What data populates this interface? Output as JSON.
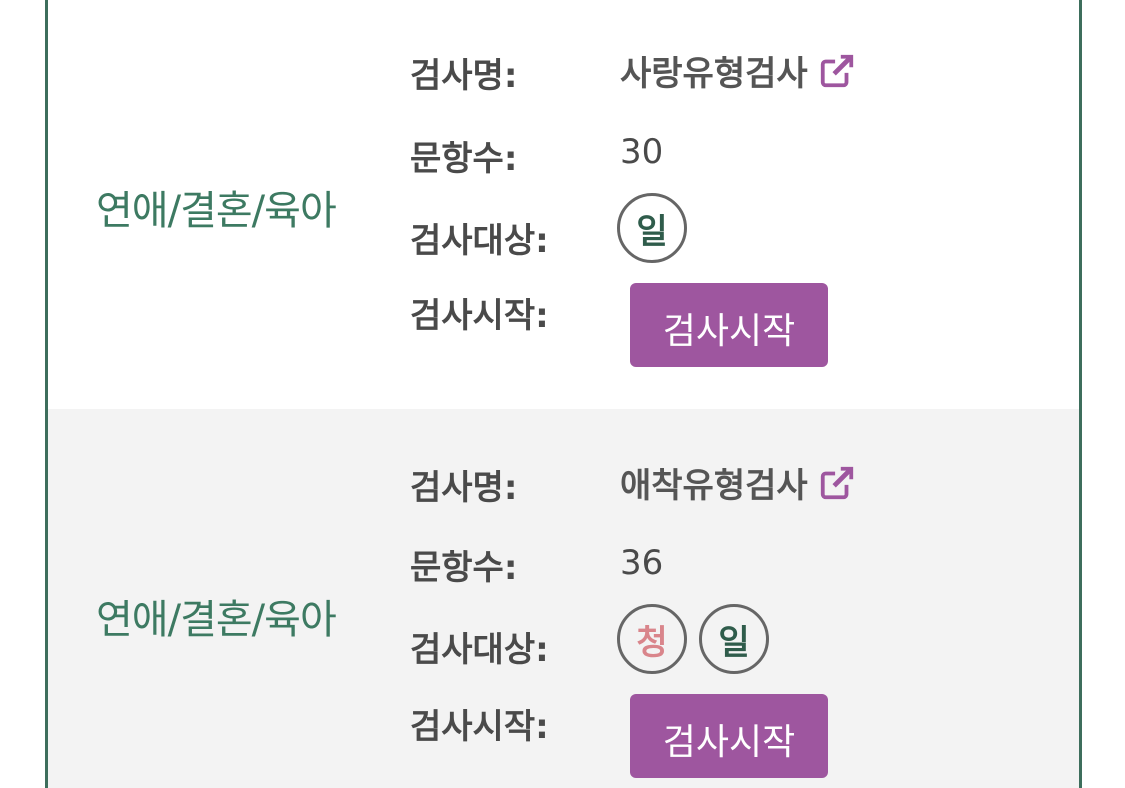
{
  "labels": {
    "test_name": "검사명:",
    "item_count": "문항수:",
    "target": "검사대상:",
    "start": "검사시작:"
  },
  "colors": {
    "brand_green": "#3d7a62",
    "button_purple": "#9e569f",
    "youth_badge": "#d9858b",
    "general_badge": "#2f5c4b"
  },
  "rows": [
    {
      "category": "연애/결혼/육아",
      "test_name": "사랑유형검사",
      "link_icon": "external-link-icon",
      "item_count": "30",
      "badges": [
        {
          "text": "일",
          "kind": "general",
          "color": "#2f5c4b"
        }
      ],
      "start_button": "검사시작"
    },
    {
      "category": "연애/결혼/육아",
      "test_name": "애착유형검사",
      "link_icon": "external-link-icon",
      "item_count": "36",
      "badges": [
        {
          "text": "청",
          "kind": "youth",
          "color": "#d9858b"
        },
        {
          "text": "일",
          "kind": "general",
          "color": "#2f5c4b"
        }
      ],
      "start_button": "검사시작"
    }
  ]
}
